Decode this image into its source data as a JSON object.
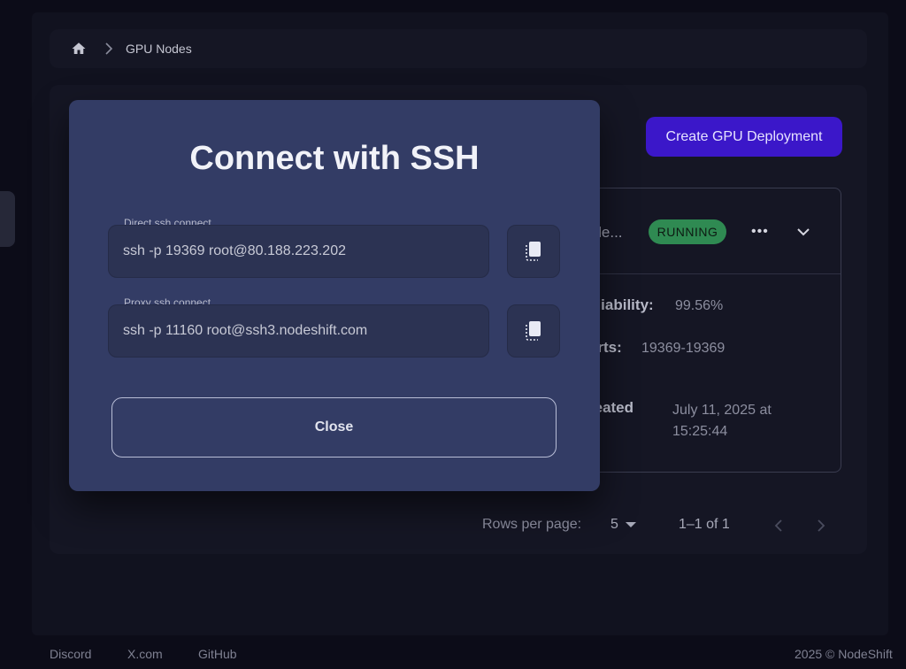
{
  "breadcrumb": {
    "current": "GPU Nodes"
  },
  "toolbar": {
    "create_label": "Create GPU Deployment"
  },
  "node": {
    "name_partial": "j-de...",
    "status": "RUNNING",
    "reliability_label": "eliability:",
    "reliability_value": "99.56%",
    "ports_label": "orts:",
    "ports_value": "19369-19369",
    "created_label_line1": "reated",
    "created_label_line2": ":",
    "created_value_line1": "July 11, 2025 at",
    "created_value_line2": "15:25:44"
  },
  "pagination": {
    "rows_label": "Rows per page:",
    "rows_value": "5",
    "range": "1–1 of 1"
  },
  "footer": {
    "links": [
      "Discord",
      "X.com",
      "GitHub"
    ],
    "copyright": "2025 © NodeShift"
  },
  "modal": {
    "title": "Connect with SSH",
    "direct_label": "Direct ssh connect",
    "direct_value": "ssh -p 19369 root@80.188.223.202",
    "proxy_label": "Proxy ssh connect",
    "proxy_value": "ssh -p 11160 root@ssh3.nodeshift.com",
    "close_label": "Close"
  },
  "colors": {
    "accent": "#3b17c9",
    "running": "#2f8a52",
    "modal_bg": "#333c65"
  }
}
